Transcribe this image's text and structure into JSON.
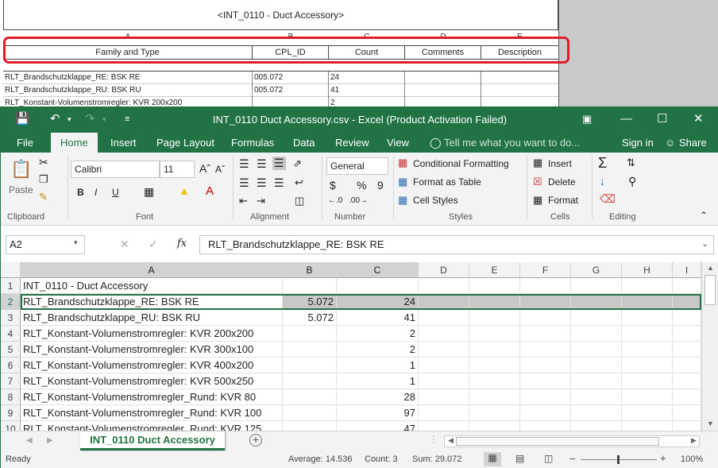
{
  "schedule": {
    "title": "<INT_0110 - Duct Accessory>",
    "col_letters": [
      "A",
      "B",
      "C",
      "D",
      "E"
    ],
    "headers": [
      "Family and Type",
      "CPL_ID",
      "Count",
      "Comments",
      "Description"
    ],
    "rows": [
      [
        "RLT_Brandschutzklappe_RE: BSK RE",
        "005.072",
        "24",
        "",
        ""
      ],
      [
        "RLT_Brandschutzklappe_RU: BSK RU",
        "005.072",
        "41",
        "",
        ""
      ],
      [
        "RLT_Konstant-Volumenstromregler: KVR 200x200",
        "",
        "2",
        "",
        ""
      ]
    ]
  },
  "excel": {
    "title": "INT_0110  Duct Accessory.csv - Excel (Product Activation Failed)",
    "tabs": [
      "File",
      "Home",
      "Insert",
      "Page Layout",
      "Formulas",
      "Data",
      "Review",
      "View"
    ],
    "tell_me": "Tell me what you want to do...",
    "sign_in": "Sign in",
    "share": "Share",
    "ribbon": {
      "clipboard": {
        "paste": "Paste",
        "label": "Clipboard"
      },
      "font": {
        "name": "Calibri",
        "size": "11",
        "bold": "B",
        "italic": "I",
        "underline": "U",
        "label": "Font"
      },
      "alignment": {
        "label": "Alignment"
      },
      "number": {
        "format": "General",
        "currency": "$",
        "percent": "%",
        "comma": "9",
        "label": "Number"
      },
      "styles": {
        "conditional": "Conditional Formatting",
        "table": "Format as Table",
        "cell": "Cell Styles",
        "label": "Styles"
      },
      "cells": {
        "insert": "Insert",
        "delete": "Delete",
        "format": "Format",
        "label": "Cells"
      },
      "editing": {
        "label": "Editing"
      }
    },
    "name_box": "A2",
    "fx": "fx",
    "formula": "RLT_Brandschutzklappe_RE: BSK RE",
    "columns": [
      "A",
      "B",
      "C",
      "D",
      "E",
      "F",
      "G",
      "H",
      "I"
    ],
    "rows": [
      {
        "n": "1",
        "a": "INT_0110 - Duct Accessory",
        "b": "",
        "c": ""
      },
      {
        "n": "2",
        "a": "RLT_Brandschutzklappe_RE: BSK RE",
        "b": "5.072",
        "c": "24"
      },
      {
        "n": "3",
        "a": "RLT_Brandschutzklappe_RU: BSK RU",
        "b": "5.072",
        "c": "41"
      },
      {
        "n": "4",
        "a": "RLT_Konstant-Volumenstromregler: KVR 200x200",
        "b": "",
        "c": "2"
      },
      {
        "n": "5",
        "a": "RLT_Konstant-Volumenstromregler: KVR 300x100",
        "b": "",
        "c": "2"
      },
      {
        "n": "6",
        "a": "RLT_Konstant-Volumenstromregler: KVR 400x200",
        "b": "",
        "c": "1"
      },
      {
        "n": "7",
        "a": "RLT_Konstant-Volumenstromregler: KVR 500x250",
        "b": "",
        "c": "1"
      },
      {
        "n": "8",
        "a": "RLT_Konstant-Volumenstromregler_Rund: KVR 80",
        "b": "",
        "c": "28"
      },
      {
        "n": "9",
        "a": "RLT_Konstant-Volumenstromregler_Rund: KVR 100",
        "b": "",
        "c": "97"
      },
      {
        "n": "10",
        "a": "RLT_Konstant-Volumenstromregler_Rund: KVR 125",
        "b": "",
        "c": "47"
      }
    ],
    "sheet_tab": "INT_0110  Duct Accessory",
    "status": {
      "ready": "Ready",
      "average": "Average: 14.536",
      "count": "Count: 3",
      "sum": "Sum: 29.072",
      "zoom": "100%"
    }
  }
}
